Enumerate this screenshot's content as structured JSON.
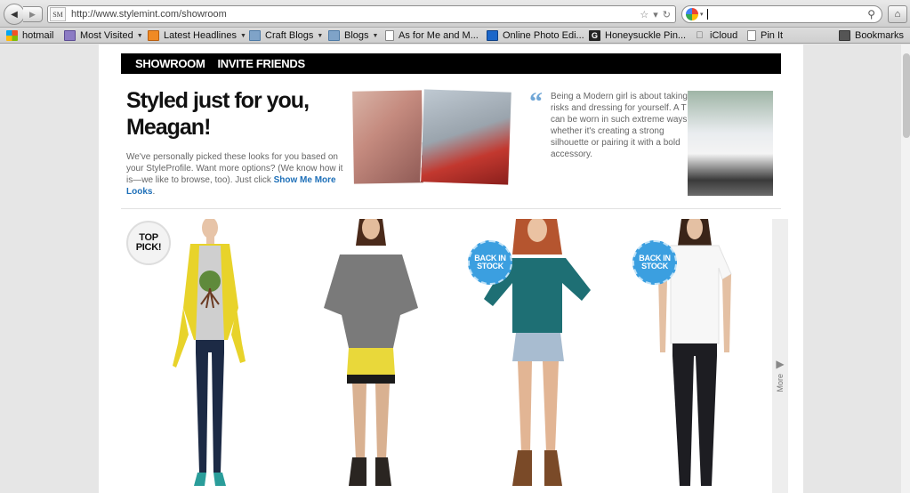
{
  "browser": {
    "site_icon": "SM",
    "url": "http://www.stylemint.com/showroom",
    "search_value": "",
    "bookmarks": [
      {
        "label": "hotmail",
        "icon": "windows-icon",
        "dropdown": false
      },
      {
        "label": "Most Visited",
        "icon": "folder-icon",
        "dropdown": true
      },
      {
        "label": "Latest Headlines",
        "icon": "rss-icon",
        "dropdown": true
      },
      {
        "label": "Craft Blogs",
        "icon": "folder-icon",
        "dropdown": true
      },
      {
        "label": "Blogs",
        "icon": "folder-icon",
        "dropdown": true
      },
      {
        "label": "As for Me and M...",
        "icon": "page-icon",
        "dropdown": false
      },
      {
        "label": "Online Photo Edi...",
        "icon": "photo-editor-icon",
        "dropdown": false
      },
      {
        "label": "Honeysuckle Pin...",
        "icon": "g-icon",
        "dropdown": false
      },
      {
        "label": "iCloud",
        "icon": "apple-icon",
        "dropdown": false
      },
      {
        "label": "Pin It",
        "icon": "page-icon",
        "dropdown": false
      }
    ],
    "bookmarks_menu": "Bookmarks"
  },
  "site": {
    "nav": {
      "showroom": "SHOWROOM",
      "invite": "INVITE FRIENDS"
    },
    "headline": "Styled just for you, Meagan!",
    "intro_text": "We've personally picked these looks for you based on your StyleProfile. Want more options? (We know how it is—we like to browse, too). Just click ",
    "intro_link": "Show Me More Looks",
    "intro_end": ".",
    "quote": "Being a Modern girl is about taking risks and dressing for yourself. A T can be worn in such extreme ways whether it's creating a strong silhouette or pairing it with a bold accessory.",
    "more_label": "More",
    "badges": {
      "top_pick": "TOP PICK!",
      "back_in_stock": "BACK IN STOCK"
    }
  },
  "colors": {
    "accent_blue": "#3b9fe0",
    "link_blue": "#1d6fb8",
    "nav_black": "#000000"
  }
}
